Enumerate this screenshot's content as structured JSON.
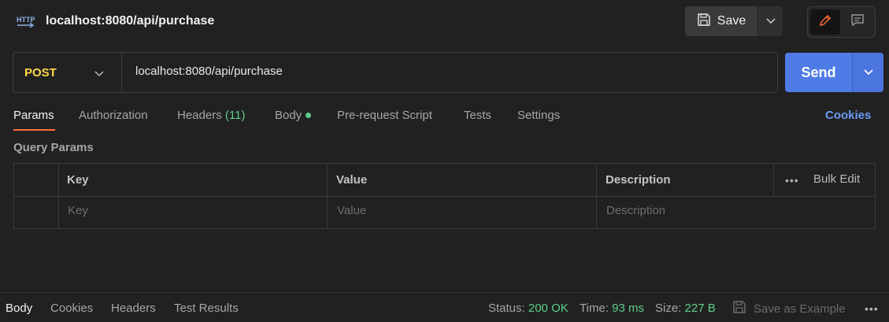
{
  "request": {
    "title": "localhost:8080/api/purchase",
    "method": "POST",
    "url": "localhost:8080/api/purchase"
  },
  "toolbar": {
    "save_label": "Save",
    "send_label": "Send"
  },
  "tabs": [
    {
      "label": "Params",
      "active": true
    },
    {
      "label": "Authorization"
    },
    {
      "label": "Headers",
      "count": "(11)"
    },
    {
      "label": "Body",
      "has_dot": true
    },
    {
      "label": "Pre-request Script"
    },
    {
      "label": "Tests"
    },
    {
      "label": "Settings"
    }
  ],
  "cookies_label": "Cookies",
  "query_params": {
    "title": "Query Params",
    "columns": [
      "Key",
      "Value",
      "Description"
    ],
    "bulk_dots": "•••",
    "bulk_edit": "Bulk Edit",
    "placeholders": [
      "Key",
      "Value",
      "Description"
    ]
  },
  "response_tabs": [
    "Body",
    "Cookies",
    "Headers",
    "Test Results"
  ],
  "status": {
    "status_label": "Status:",
    "status_value": "200 OK",
    "time_label": "Time:",
    "time_value": "93 ms",
    "size_label": "Size:",
    "size_value": "227 B"
  },
  "save_example_label": "Save as Example",
  "more_dots": "•••",
  "colors": {
    "accent_orange": "#ff6c37",
    "send_blue": "#4f7be6",
    "method_yellow": "#ffd84a",
    "success_green": "#5ecf89",
    "link_blue": "#6a9bf4"
  },
  "icons": [
    "http-icon",
    "save-icon",
    "chevron-down-icon",
    "pencil-icon",
    "comment-icon",
    "disk-icon"
  ]
}
